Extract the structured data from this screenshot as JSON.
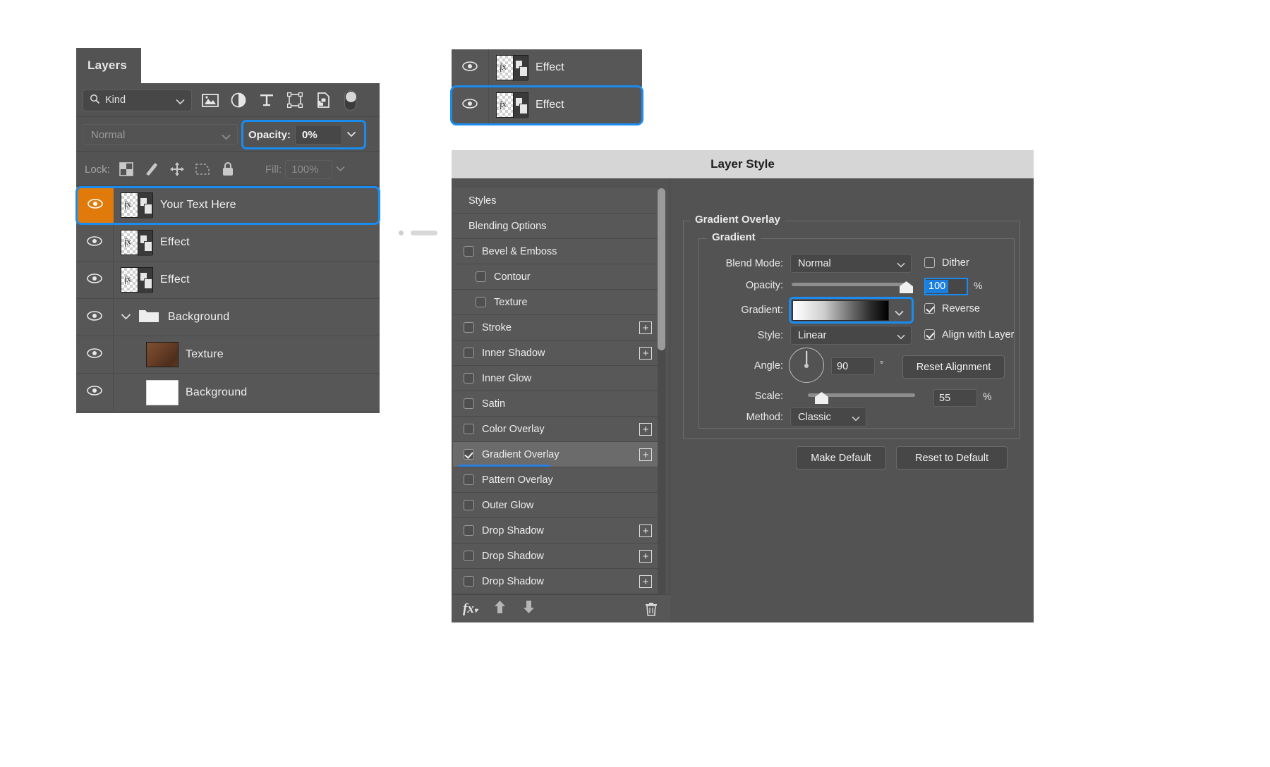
{
  "layers_panel": {
    "tab_label": "Layers",
    "filter": {
      "kind_label": "Kind",
      "icons": [
        "pixel-layer-filter-icon",
        "adjustment-layer-filter-icon",
        "type-layer-filter-icon",
        "shape-layer-filter-icon",
        "smart-object-filter-icon"
      ],
      "toggle_name": "filter-enable-toggle"
    },
    "blend_mode": "Normal",
    "opacity_label": "Opacity:",
    "opacity_value": "0%",
    "lock_label": "Lock:",
    "lock_icons": [
      "lock-transparent-pixels-icon",
      "lock-image-pixels-icon",
      "lock-position-icon",
      "lock-artboard-nesting-icon",
      "lock-all-icon"
    ],
    "fill_label": "Fill:",
    "fill_value": "100%",
    "layers": [
      {
        "name": "Your Text Here",
        "thumb": "text-effect-thumbnail",
        "visible": true,
        "selected": true,
        "indent": false
      },
      {
        "name": "Effect",
        "thumb": "text-effect-thumbnail",
        "visible": true,
        "selected": false,
        "indent": false
      },
      {
        "name": "Effect",
        "thumb": "text-effect-thumbnail",
        "visible": true,
        "selected": false,
        "indent": false
      },
      {
        "name": "Background",
        "thumb": "folder-icon",
        "visible": true,
        "selected": false,
        "indent": false,
        "group": true
      },
      {
        "name": "Texture",
        "thumb": "texture-thumbnail",
        "visible": true,
        "selected": false,
        "indent": true
      },
      {
        "name": "Background",
        "thumb": "white-thumbnail",
        "visible": true,
        "selected": false,
        "indent": true
      }
    ]
  },
  "effect_rows": [
    {
      "name": "Effect",
      "visible": true,
      "highlighted": false
    },
    {
      "name": "Effect",
      "visible": true,
      "highlighted": true
    }
  ],
  "layer_style": {
    "title": "Layer Style",
    "styles_list": [
      {
        "label": "Styles",
        "type": "header",
        "checkbox": false,
        "checked": false,
        "plus": false,
        "active": false,
        "sub": false
      },
      {
        "label": "Blending Options",
        "type": "header",
        "checkbox": false,
        "checked": false,
        "plus": false,
        "active": false,
        "sub": false
      },
      {
        "label": "Bevel & Emboss",
        "type": "item",
        "checkbox": true,
        "checked": false,
        "plus": false,
        "active": false,
        "sub": false
      },
      {
        "label": "Contour",
        "type": "item",
        "checkbox": true,
        "checked": false,
        "plus": false,
        "active": false,
        "sub": true
      },
      {
        "label": "Texture",
        "type": "item",
        "checkbox": true,
        "checked": false,
        "plus": false,
        "active": false,
        "sub": true
      },
      {
        "label": "Stroke",
        "type": "item",
        "checkbox": true,
        "checked": false,
        "plus": true,
        "active": false,
        "sub": false
      },
      {
        "label": "Inner Shadow",
        "type": "item",
        "checkbox": true,
        "checked": false,
        "plus": true,
        "active": false,
        "sub": false
      },
      {
        "label": "Inner Glow",
        "type": "item",
        "checkbox": true,
        "checked": false,
        "plus": false,
        "active": false,
        "sub": false
      },
      {
        "label": "Satin",
        "type": "item",
        "checkbox": true,
        "checked": false,
        "plus": false,
        "active": false,
        "sub": false
      },
      {
        "label": "Color Overlay",
        "type": "item",
        "checkbox": true,
        "checked": false,
        "plus": true,
        "active": false,
        "sub": false
      },
      {
        "label": "Gradient Overlay",
        "type": "item",
        "checkbox": true,
        "checked": true,
        "plus": true,
        "active": true,
        "sub": false
      },
      {
        "label": "Pattern Overlay",
        "type": "item",
        "checkbox": true,
        "checked": false,
        "plus": false,
        "active": false,
        "sub": false
      },
      {
        "label": "Outer Glow",
        "type": "item",
        "checkbox": true,
        "checked": false,
        "plus": false,
        "active": false,
        "sub": false
      },
      {
        "label": "Drop Shadow",
        "type": "item",
        "checkbox": true,
        "checked": false,
        "plus": true,
        "active": false,
        "sub": false
      },
      {
        "label": "Drop Shadow",
        "type": "item",
        "checkbox": true,
        "checked": false,
        "plus": true,
        "active": false,
        "sub": false
      },
      {
        "label": "Drop Shadow",
        "type": "item",
        "checkbox": true,
        "checked": false,
        "plus": true,
        "active": false,
        "sub": false
      }
    ],
    "footer_icons": [
      "fx-menu-icon",
      "move-up-icon",
      "move-down-icon",
      "trash-icon"
    ],
    "section_title": "Gradient Overlay",
    "group_title": "Gradient",
    "fields": {
      "blend_mode_label": "Blend Mode:",
      "blend_mode_value": "Normal",
      "dither_label": "Dither",
      "dither_checked": false,
      "opacity_label": "Opacity:",
      "opacity_value": "100",
      "opacity_unit": "%",
      "gradient_label": "Gradient:",
      "reverse_label": "Reverse",
      "reverse_checked": true,
      "style_label": "Style:",
      "style_value": "Linear",
      "align_label": "Align with Layer",
      "align_checked": true,
      "angle_label": "Angle:",
      "angle_value": "90",
      "angle_unit": "°",
      "reset_alignment_label": "Reset Alignment",
      "scale_label": "Scale:",
      "scale_value": "55",
      "scale_unit": "%",
      "method_label": "Method:",
      "method_value": "Classic"
    },
    "buttons": {
      "make_default": "Make Default",
      "reset_to_default": "Reset to Default"
    }
  },
  "colors": {
    "accent_blue": "#1a8cf0",
    "selected_orange": "#e07b0b",
    "panel_gray": "#535353",
    "row_gray": "#575757",
    "titlebar_gray": "#d6d6d6"
  }
}
